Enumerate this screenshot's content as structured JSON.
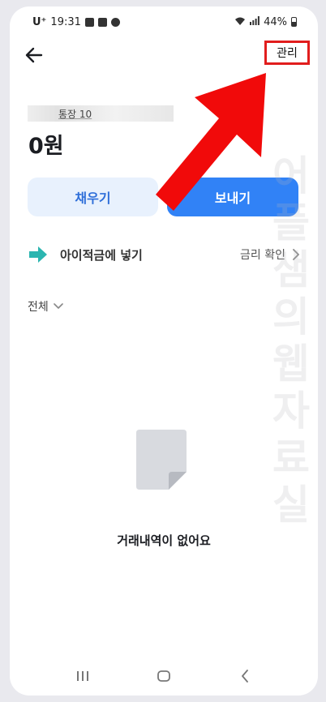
{
  "status_bar": {
    "carrier": "U⁺",
    "time": "19:31",
    "battery": "44%"
  },
  "header": {
    "back_icon": "arrow-left-icon",
    "manage_label": "관리"
  },
  "account": {
    "name": "통장 10",
    "balance": "0원"
  },
  "actions": {
    "fill_label": "채우기",
    "send_label": "보내기"
  },
  "savings": {
    "title": "아이적금에 넣기",
    "rate_check": "금리 확인",
    "icon": "teal-arrow-right-icon"
  },
  "filter": {
    "selected": "전체"
  },
  "empty_state": {
    "message": "거래내역이 없어요",
    "icon": "document-icon"
  },
  "watermark": {
    "text": "어플샘의웹자료실"
  },
  "nav": {
    "recent": "recent-apps-icon",
    "home": "home-icon",
    "back": "back-icon"
  },
  "colors": {
    "primary": "#3182f6",
    "primary_light": "#e8f1fd",
    "accent_teal": "#2bb5b0",
    "annotation_red": "#e11d1d"
  }
}
